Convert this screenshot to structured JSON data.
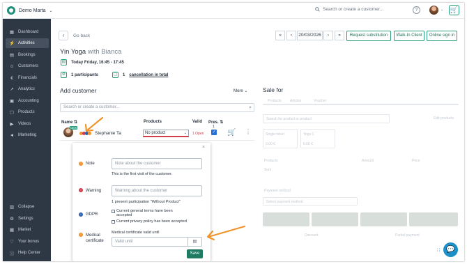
{
  "topbar": {
    "account_name": "Demo Marta",
    "search_placeholder": "Search or create a customer..."
  },
  "sidebar": {
    "items": [
      {
        "label": "Dashboard",
        "icon": "dashboard-icon"
      },
      {
        "label": "Activities",
        "icon": "lightning-icon"
      },
      {
        "label": "Bookings",
        "icon": "calendar-icon"
      },
      {
        "label": "Customers",
        "icon": "user-icon"
      },
      {
        "label": "Financials",
        "icon": "euro-icon"
      },
      {
        "label": "Analytics",
        "icon": "chart-icon"
      },
      {
        "label": "Accounting",
        "icon": "clipboard-icon"
      },
      {
        "label": "Products",
        "icon": "box-icon"
      },
      {
        "label": "Videos",
        "icon": "play-icon"
      },
      {
        "label": "Marketing",
        "icon": "megaphone-icon"
      }
    ],
    "bottom_items": [
      {
        "label": "Collapse",
        "icon": "collapse-icon"
      },
      {
        "label": "Settings",
        "icon": "gear-icon"
      },
      {
        "label": "Market",
        "icon": "store-icon"
      },
      {
        "label": "Your bonus",
        "icon": "heart-icon"
      },
      {
        "label": "Help Center",
        "icon": "help-icon"
      }
    ]
  },
  "header": {
    "back_label": "Go back",
    "date": "20/03/2026",
    "buttons": [
      "Request substitution",
      "Walk-In Client",
      "Online sign in"
    ]
  },
  "activity": {
    "title": "Yin Yoga",
    "with_text": "with Bianca",
    "time": "Today Friday, 16:45 - 17:45",
    "participants": "1 participants",
    "cancellation_count": "1",
    "cancellation_text": "cancellation in total"
  },
  "add_customer": {
    "title": "Add customer",
    "more": "More",
    "search_placeholder": "Search or create a customer...",
    "columns": [
      "Name",
      "Products",
      "Valid",
      "Pres."
    ],
    "row": {
      "name": "Stephanie Ta",
      "badge": "NEW",
      "product": "No product",
      "valid": "1 Open",
      "pres_count": "1"
    }
  },
  "popover": {
    "note_label": "Note",
    "note_placeholder": "Note about the customer",
    "note_info": "This is the first visit of the customer.",
    "warning_label": "Warning",
    "warning_placeholder": "Warning about the customer",
    "warning_info": "1 present participation \"Without Product\"",
    "gdpr_label": "GDPR",
    "gdpr_terms": "Current general terms have been accepted",
    "gdpr_privacy": "Current privacy policy has been accepted",
    "medical_label": "Medical certificate",
    "medical_info": "Medical certificate valid until",
    "medical_placeholder": "Valid until",
    "save": "Save"
  },
  "sale": {
    "title": "Sale for",
    "tabs": [
      "Products",
      "Articles",
      "Voucher"
    ],
    "search_placeholder": "Search for product or product",
    "link": "Edit products",
    "chips": [
      {
        "name": "Single ticket",
        "price": "0.00 €"
      },
      {
        "name": "Yoga 1",
        "price": "0.00 €"
      }
    ],
    "table_headers": [
      "Products",
      "Amount",
      "Price"
    ],
    "row": "Sum",
    "payment_label": "Payment method",
    "payment_placeholder": "Select payment method",
    "footer": [
      "Discount",
      "Partial payment"
    ]
  },
  "colors": {
    "accent": "#2a9d7c",
    "sidebar": "#2e3744",
    "warning": "#d23b4b",
    "annotation_arrow": "#f0932b"
  }
}
